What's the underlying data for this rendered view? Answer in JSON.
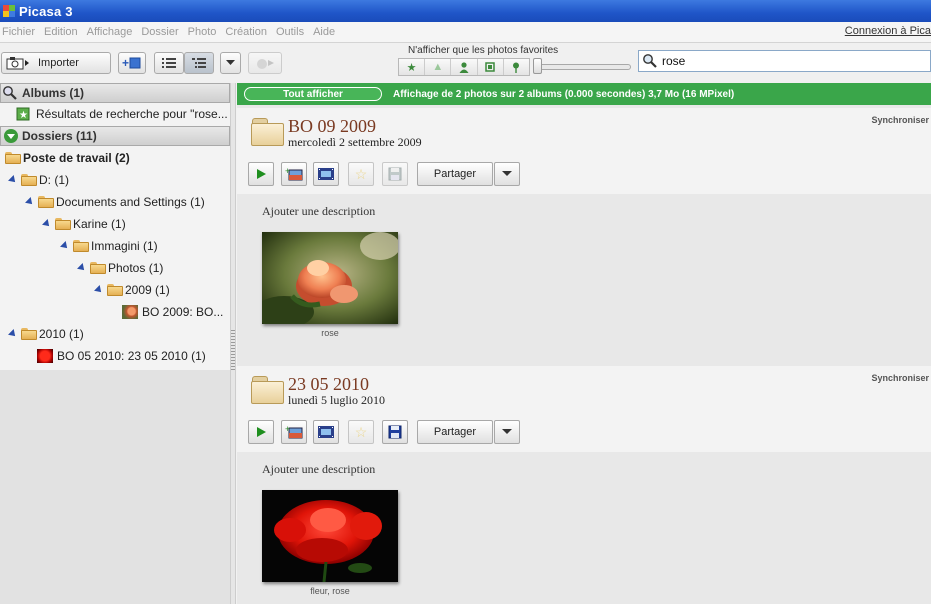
{
  "app": {
    "title": "Picasa 3"
  },
  "menu": {
    "items": [
      "Fichier",
      "Edition",
      "Affichage",
      "Dossier",
      "Photo",
      "Création",
      "Outils",
      "Aide"
    ],
    "connexion": "Connexion à Pica"
  },
  "toolbar": {
    "import_label": "Importer",
    "favorites_label": "N'afficher que les photos favorites",
    "search_value": "rose"
  },
  "sidebar": {
    "albums_header": "Albums (1)",
    "search_results": "Résultats de recherche pour \"rose...",
    "folders_header": "Dossiers (11)",
    "tree": [
      "Poste de travail (2)",
      "D: (1)",
      "Documents and Settings (1)",
      "Karine (1)",
      "Immagini (1)",
      "Photos (1)",
      "2009 (1)",
      "BO 2009: BO...",
      "2010 (1)",
      "BO 05 2010: 23 05 2010 (1)"
    ]
  },
  "library": {
    "show_all": "Tout afficher",
    "status": "Affichage de 2 photos sur 2 albums (0.000 secondes) 3,7 Mo (16 MPixel)",
    "albums": [
      {
        "title": "BO 09 2009",
        "date": "mercoledì 2 settembre 2009",
        "sync": "Synchroniser",
        "share": "Partager",
        "description": "Ajouter une description",
        "photo_caption": "rose"
      },
      {
        "title": "23 05 2010",
        "date": "lunedì 5 luglio 2010",
        "sync": "Synchroniser",
        "share": "Partager",
        "description": "Ajouter une description",
        "photo_caption": "fleur, rose"
      }
    ]
  },
  "colors": {
    "titlebar": "#1f55c8",
    "status_bar": "#3aa64a",
    "album_title": "#7a3a22"
  }
}
